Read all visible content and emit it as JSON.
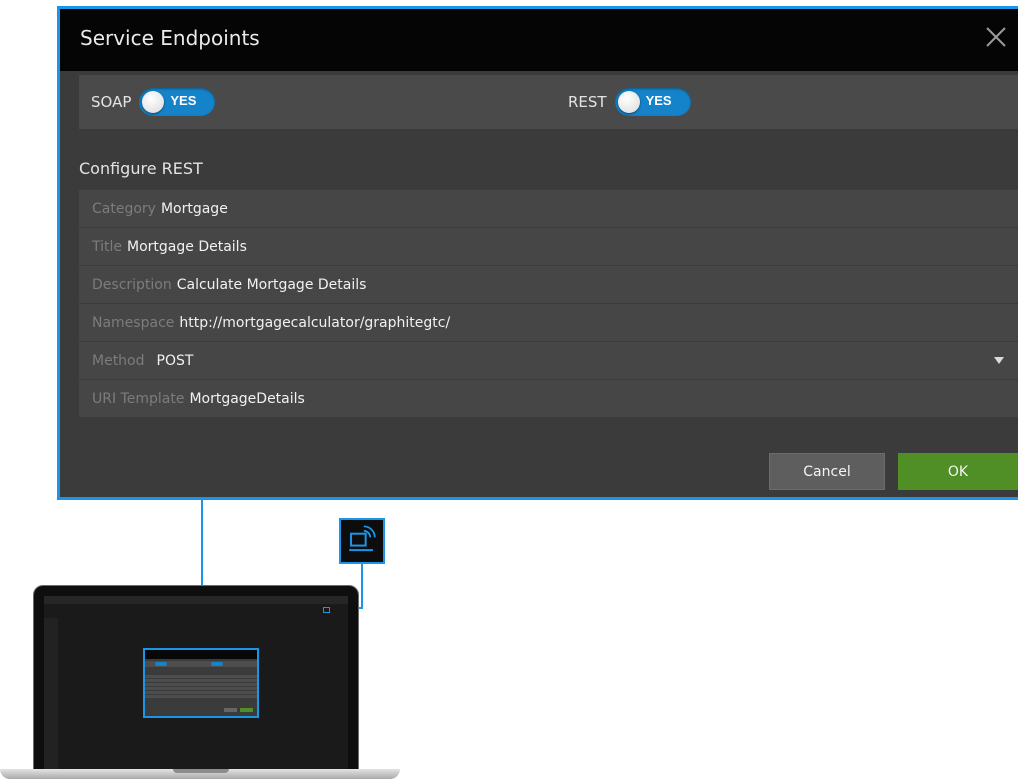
{
  "dialog": {
    "title": "Service Endpoints",
    "soap": {
      "label": "SOAP",
      "state": "YES"
    },
    "rest": {
      "label": "REST",
      "state": "YES"
    },
    "section_title": "Configure REST",
    "fields": {
      "category": {
        "label": "Category",
        "value": "Mortgage"
      },
      "title": {
        "label": "Title",
        "value": "Mortgage Details"
      },
      "description": {
        "label": "Description",
        "value": "Calculate Mortgage Details"
      },
      "namespace": {
        "label": "Namespace",
        "value": "http://mortgagecalculator/graphitegtc/"
      },
      "method": {
        "label": "Method",
        "value": "POST"
      },
      "uri_template": {
        "label": "URI Template",
        "value": "MortgageDetails"
      }
    },
    "buttons": {
      "cancel": "Cancel",
      "ok": "OK"
    }
  },
  "colors": {
    "accent": "#1b95e6",
    "toggle_on": "#1583c9",
    "ok_button": "#4f8f26",
    "dialog_bg": "#3b3b3b",
    "titlebar_bg": "#050505"
  },
  "icons": {
    "close": "close-icon",
    "feature": "rest-endpoint-icon",
    "method_dropdown": "caret-down-icon"
  }
}
